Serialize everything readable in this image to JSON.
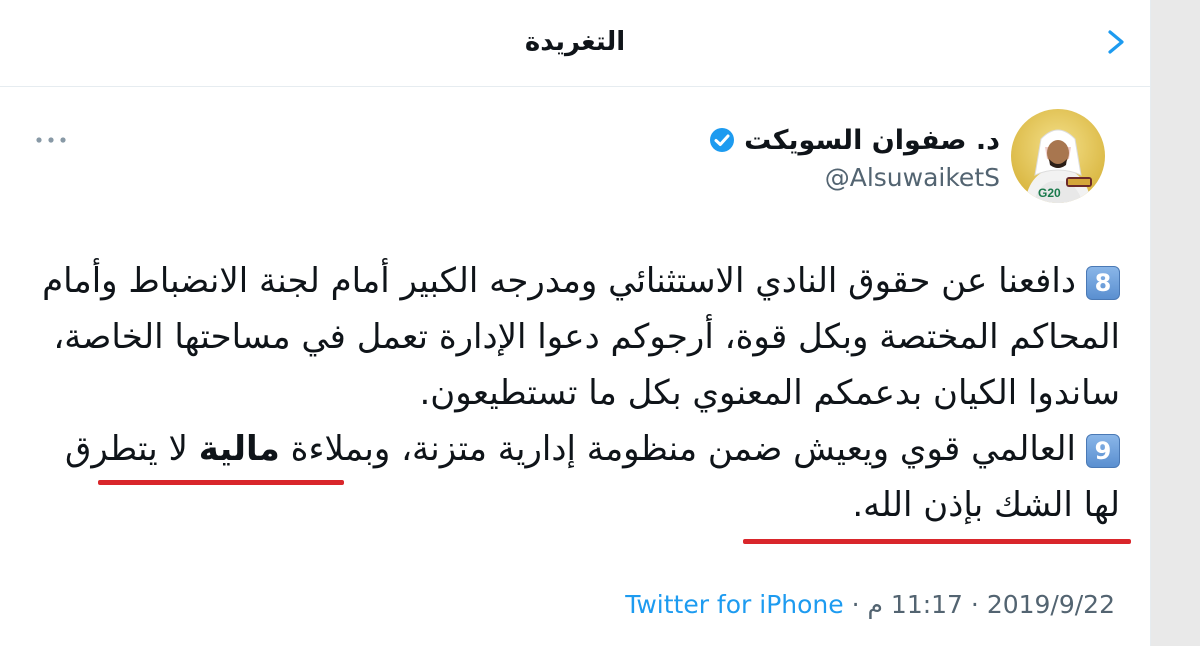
{
  "header": {
    "title": "التغريدة"
  },
  "author": {
    "name": "د. صفوان السويكت",
    "handle": "@AlsuwaiketS",
    "avatar_badge": "G20"
  },
  "tweet": {
    "item8_marker": "8",
    "item8_text": "دافعنا عن حقوق النادي الاستثنائي ومدرجه الكبير أمام لجنة الانضباط وأمام المحاكم المختصة وبكل قوة، أرجوكم دعوا الإدارة تعمل في مساحتها الخاصة، ساندوا الكيان بدعمكم المعنوي بكل ما تستطيعون.",
    "item9_marker": "9",
    "item9_before": "العالمي قوي ويعيش ضمن منظومة إدارية متزنة، وبملاءة ",
    "item9_bold": "مالية",
    "item9_after": " لا يتطرق لها الشك بإذن الله."
  },
  "meta": {
    "date": "2019/9/22",
    "sep1": " · ",
    "time": "11:17 م",
    "sep2": " · ",
    "source": "Twitter for iPhone"
  },
  "colors": {
    "accent": "#1d9bf0",
    "underline": "#d9262b",
    "muted": "#536471"
  },
  "icons": [
    "chevron-back-icon",
    "verified-badge-icon",
    "more-options-icon"
  ]
}
